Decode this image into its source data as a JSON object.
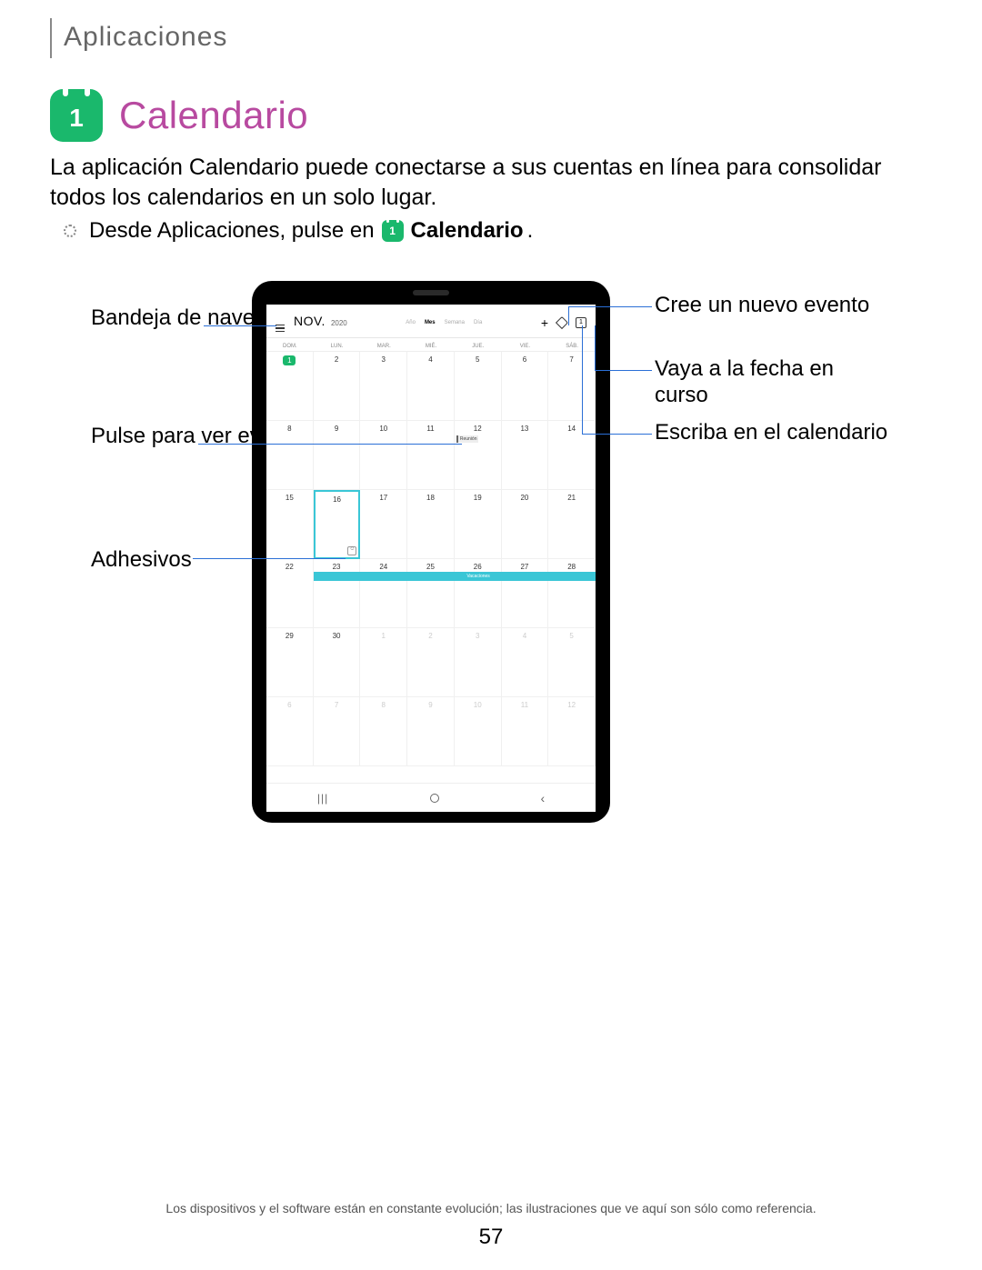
{
  "section": "Aplicaciones",
  "app": {
    "icon_number": "1",
    "title": "Calendario",
    "description": "La aplicación Calendario puede conectarse a sus cuentas en línea para consolidar todos los calendarios en un solo lugar.",
    "instruction_prefix": "Desde Aplicaciones, pulse en",
    "instruction_app": "Calendario"
  },
  "callouts": {
    "nav_drawer": "Bandeja de navegación",
    "tap_event": "Pulse para ver evento",
    "stickers": "Adhesivos",
    "new_event": "Cree un nuevo evento",
    "goto_today": "Vaya a la fecha en curso",
    "write_cal": "Escriba en el calendario"
  },
  "calendar": {
    "month": "NOV.",
    "year": "2020",
    "views": {
      "year": "Año",
      "month": "Mes",
      "week": "Semana",
      "day": "Día"
    },
    "dow": [
      "DOM.",
      "LUN.",
      "MAR.",
      "MIÉ.",
      "JUE.",
      "VIE.",
      "SÁB."
    ],
    "event_label": "Reunión",
    "vacation_label": "Vacaciones",
    "weeks": [
      [
        {
          "d": "1",
          "today": true
        },
        {
          "d": "2"
        },
        {
          "d": "3"
        },
        {
          "d": "4"
        },
        {
          "d": "5"
        },
        {
          "d": "6"
        },
        {
          "d": "7"
        }
      ],
      [
        {
          "d": "8"
        },
        {
          "d": "9"
        },
        {
          "d": "10"
        },
        {
          "d": "11"
        },
        {
          "d": "12",
          "event": true
        },
        {
          "d": "13"
        },
        {
          "d": "14"
        }
      ],
      [
        {
          "d": "15"
        },
        {
          "d": "16",
          "hl": true,
          "sticker": true
        },
        {
          "d": "17"
        },
        {
          "d": "18"
        },
        {
          "d": "19"
        },
        {
          "d": "20"
        },
        {
          "d": "21"
        }
      ],
      [
        {
          "d": "22"
        },
        {
          "d": "23",
          "vac": true
        },
        {
          "d": "24"
        },
        {
          "d": "25"
        },
        {
          "d": "26"
        },
        {
          "d": "27"
        },
        {
          "d": "28"
        }
      ],
      [
        {
          "d": "29"
        },
        {
          "d": "30"
        },
        {
          "d": "1",
          "dim": true
        },
        {
          "d": "2",
          "dim": true
        },
        {
          "d": "3",
          "dim": true
        },
        {
          "d": "4",
          "dim": true
        },
        {
          "d": "5",
          "dim": true
        }
      ],
      [
        {
          "d": "6",
          "dim": true
        },
        {
          "d": "7",
          "dim": true
        },
        {
          "d": "8",
          "dim": true
        },
        {
          "d": "9",
          "dim": true
        },
        {
          "d": "10",
          "dim": true
        },
        {
          "d": "11",
          "dim": true
        },
        {
          "d": "12",
          "dim": true
        }
      ]
    ]
  },
  "footnote": "Los dispositivos y el software están en constante evolución; las ilustraciones que ve aquí son sólo como referencia.",
  "page_number": "57"
}
